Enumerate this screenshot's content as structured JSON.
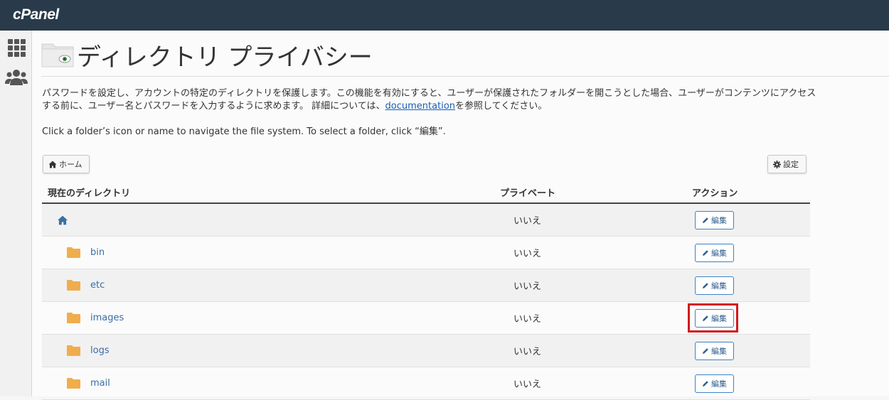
{
  "app": {
    "logo": "cPanel"
  },
  "sidebar": {
    "items": [
      {
        "icon": "grid-icon"
      },
      {
        "icon": "users-icon"
      }
    ]
  },
  "page": {
    "title": "ディレクトリ プライバシー",
    "description_before_link": "パスワードを設定し、アカウントの特定のディレクトリを保護します。この機能を有効にすると、ユーザーが保護されたフォルダーを開こうとした場合、ユーザーがコンテンツにアクセスする前に、ユーザー名とパスワードを入力するように求めます。 詳細については、",
    "description_link": "documentation",
    "description_after_link": "を参照してください。",
    "nav_hint": "Click a folder’s icon or name to navigate the file system. To select a folder, click “編集”."
  },
  "toolbar": {
    "home_label": "ホーム",
    "settings_label": "設定"
  },
  "table": {
    "headers": {
      "directory": "現在のディレクトリ",
      "private": "プライベート",
      "action": "アクション"
    },
    "edit_label": "編集",
    "rows": [
      {
        "name": "",
        "type": "home",
        "private": "いいえ"
      },
      {
        "name": "bin",
        "type": "folder",
        "private": "いいえ"
      },
      {
        "name": "etc",
        "type": "folder",
        "private": "いいえ"
      },
      {
        "name": "images",
        "type": "folder",
        "private": "いいえ",
        "highlighted": true
      },
      {
        "name": "logs",
        "type": "folder",
        "private": "いいえ"
      },
      {
        "name": "mail",
        "type": "folder",
        "private": "いいえ"
      }
    ]
  },
  "colors": {
    "topbar": "#293a4a",
    "link": "#3a6ea5",
    "folder": "#f0ad4e",
    "highlight": "#d2191c"
  }
}
